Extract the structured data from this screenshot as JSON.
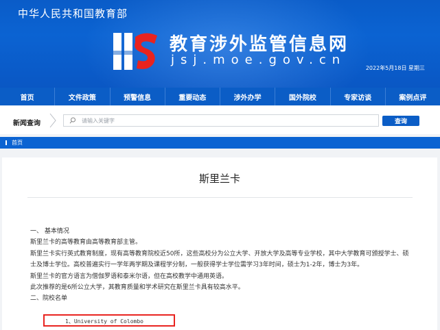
{
  "header": {
    "ministry_name": "中华人民共和国教育部",
    "site_title": "教育涉外监管信息网",
    "site_domain": "jsj.moe.gov.cn",
    "date": "2022年5月18日 星期三",
    "brand_color": "#0b5dc6"
  },
  "nav": {
    "items": [
      {
        "label": "首页"
      },
      {
        "label": "文件政策"
      },
      {
        "label": "预警信息"
      },
      {
        "label": "重要动态"
      },
      {
        "label": "涉外办学"
      },
      {
        "label": "国外院校"
      },
      {
        "label": "专家访谈"
      },
      {
        "label": "案例点评"
      }
    ]
  },
  "search": {
    "label": "新闻查询",
    "placeholder": "请输入关键字",
    "button_label": "查询"
  },
  "breadcrumb": {
    "home": "首页"
  },
  "article": {
    "title": "斯里兰卡",
    "section1_heading": "一、 基本情况",
    "paragraphs": [
      "斯里兰卡的高等教育由高等教育部主管。",
      "斯里兰卡实行英式教育制度，现有高等教育院校近50所，这些高校分为公立大学、开放大学及高等专业学校，其中大学教育可颁授学士、硕士及博士学位。高校普遍实行一学年两学期及课程学分制，一般获得学士学位需学习3年时间，硕士为1-2年，博士为3年。",
      "斯里兰卡的官方语言为僧伽罗语和泰米尔语，但在高校教学中通用英语。",
      "此次推荐的是6所公立大学，其教育质量和学术研究在斯里兰卡具有较高水平。"
    ],
    "section2_heading": "二、院校名单",
    "schools": [
      "1、University of Colombo"
    ],
    "highlight_color": "#e8231f"
  }
}
